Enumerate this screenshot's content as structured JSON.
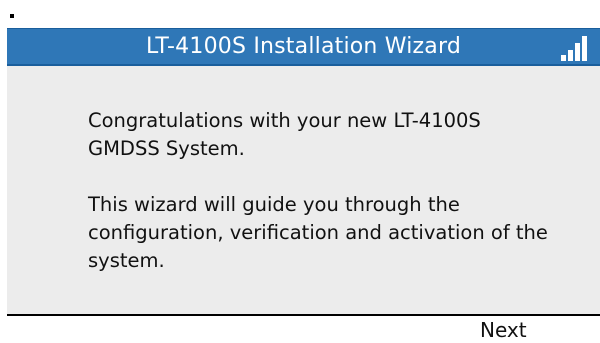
{
  "window": {
    "title": "LT-4100S Installation Wizard",
    "signal_icon": "signal-strength-icon",
    "signal_level": "4 of 4 bars"
  },
  "content": {
    "paragraph_1": "Congratulations with your new LT-4100S GMDSS System.",
    "paragraph_2": "This wizard will guide you through the configuration, verification and activation of the system."
  },
  "footer": {
    "next_label": "Next"
  },
  "colors": {
    "title_bar": "#2f77b7",
    "panel_background": "#ececec",
    "text": "#111111"
  }
}
